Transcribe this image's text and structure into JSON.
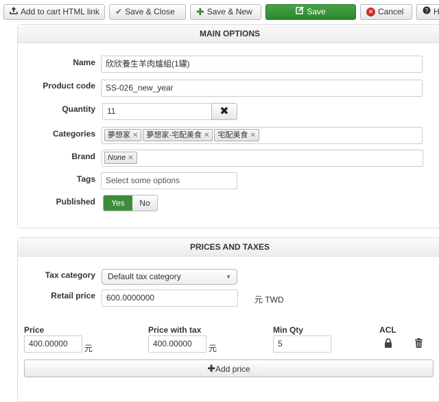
{
  "toolbar": {
    "add_to_cart_label": "Add to cart HTML link",
    "save_close_label": "Save & Close",
    "save_new_label": "Save & New",
    "save_label": "Save",
    "cancel_label": "Cancel",
    "help_label": "H"
  },
  "main_options": {
    "title": "MAIN OPTIONS",
    "name_label": "Name",
    "name_value": "欣欣養生羊肉爐組(1罐)",
    "code_label": "Product code",
    "code_value": "SS-026_new_year",
    "quantity_label": "Quantity",
    "quantity_value": "11",
    "categories_label": "Categories",
    "categories": [
      "夢想家",
      "夢想家-宅配美食",
      "宅配美食"
    ],
    "brand_label": "Brand",
    "brand_value": "None",
    "tags_label": "Tags",
    "tags_placeholder": "Select some options",
    "published_label": "Published",
    "published_yes": "Yes",
    "published_no": "No"
  },
  "prices_taxes": {
    "title": "PRICES AND TAXES",
    "tax_category_label": "Tax category",
    "tax_category_value": "Default tax category",
    "retail_price_label": "Retail price",
    "retail_price_value": "600.0000000",
    "retail_currency": "元 TWD",
    "price_label": "Price",
    "price_value": "400.00000",
    "price_currency": "元",
    "price_tax_label": "Price with tax",
    "price_tax_value": "400.00000",
    "price_tax_currency": "元",
    "min_qty_label": "Min Qty",
    "min_qty_value": "5",
    "acl_label": "ACL",
    "add_price_label": "Add price"
  }
}
